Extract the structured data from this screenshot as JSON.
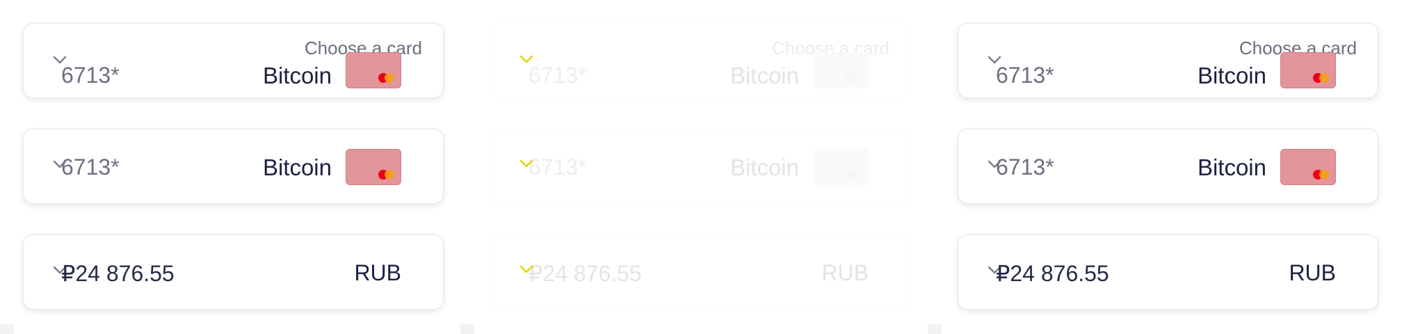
{
  "panels": [
    {
      "state": "normal",
      "rows": [
        {
          "hint": "Choose a card",
          "value": "6713*",
          "name": "Bitcoin",
          "icon": "mastercard-icon"
        },
        {
          "value": "6713*",
          "name": "Bitcoin",
          "icon": "mastercard-icon"
        },
        {
          "value": "₽24 876.55",
          "currency": "RUB"
        }
      ]
    },
    {
      "state": "faded",
      "rows": [
        {
          "hint": "Choose a card",
          "value": "6713*",
          "name": "Bitcoin",
          "icon": "mastercard-icon"
        },
        {
          "value": "6713*",
          "name": "Bitcoin",
          "icon": "mastercard-icon"
        },
        {
          "value": "₽24 876.55",
          "currency": "RUB"
        }
      ]
    },
    {
      "state": "normal",
      "rows": [
        {
          "hint": "Choose a card",
          "value": "6713*",
          "name": "Bitcoin",
          "icon": "mastercard-icon"
        },
        {
          "value": "6713*",
          "name": "Bitcoin",
          "icon": "mastercard-icon"
        },
        {
          "value": "₽24 876.55",
          "currency": "RUB"
        }
      ]
    }
  ],
  "colors": {
    "card_tile": "#e2959a",
    "text_dark": "#1c2142",
    "text_muted": "#6c6f7f",
    "chevron_normal": "#7a7d8c",
    "chevron_faded": "#e2d600"
  }
}
